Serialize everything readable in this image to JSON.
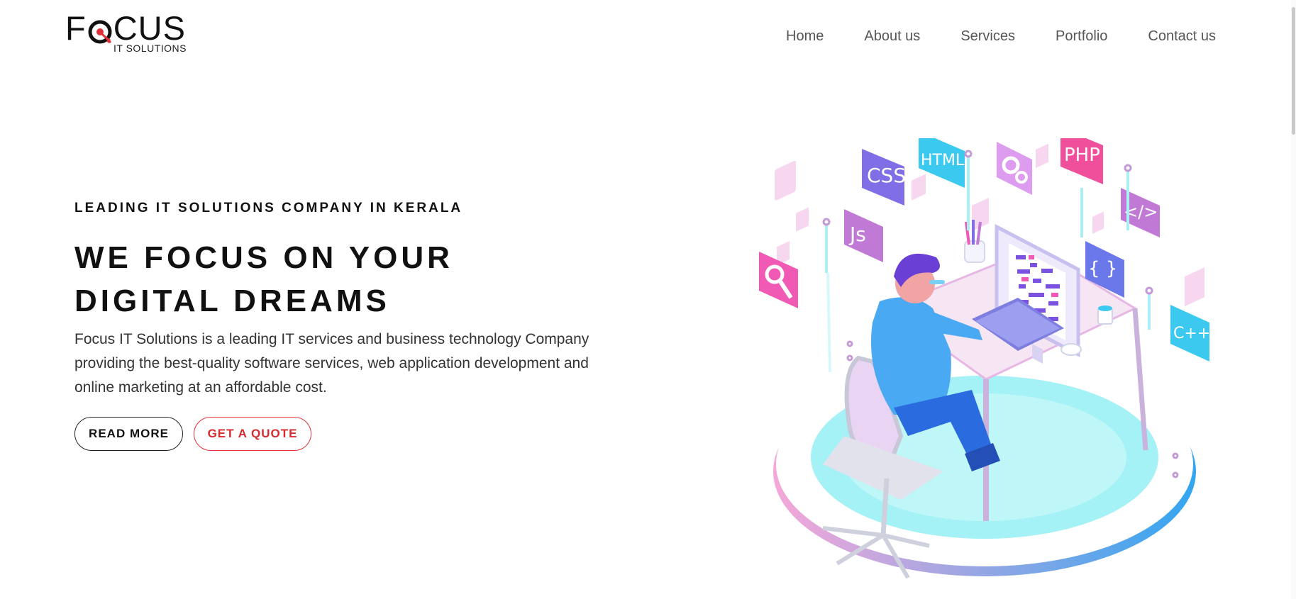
{
  "header": {
    "logo": {
      "word_left": "F",
      "word_right": "CUS",
      "subtitle": "IT SOLUTIONS"
    },
    "nav": [
      "Home",
      "About us",
      "Services",
      "Portfolio",
      "Contact us"
    ]
  },
  "hero": {
    "eyebrow": "LEADING IT SOLUTIONS COMPANY IN KERALA",
    "headline_line1": "WE FOCUS ON YOUR",
    "headline_line2": "DIGITAL DREAMS",
    "description": "Focus IT Solutions is a leading IT services and business technology Company providing the best-quality software services, web application development and online marketing at an affordable cost.",
    "read_more_label": "READ MORE",
    "quote_label": "GET A QUOTE"
  },
  "illustration": {
    "tiles": [
      "CSS",
      "HTML",
      "PHP",
      "Js",
      "{ }",
      "</>",
      "C++"
    ],
    "icons": [
      "gear-icon",
      "magnifier-icon"
    ]
  },
  "colors": {
    "accent_red": "#e0313a",
    "text_dark": "#111111",
    "nav_gray": "#555555",
    "tile_purple": "#7f6ee6",
    "tile_cyan": "#3cc9f0",
    "tile_pink": "#f0509b",
    "tile_violet": "#c07ad6"
  }
}
